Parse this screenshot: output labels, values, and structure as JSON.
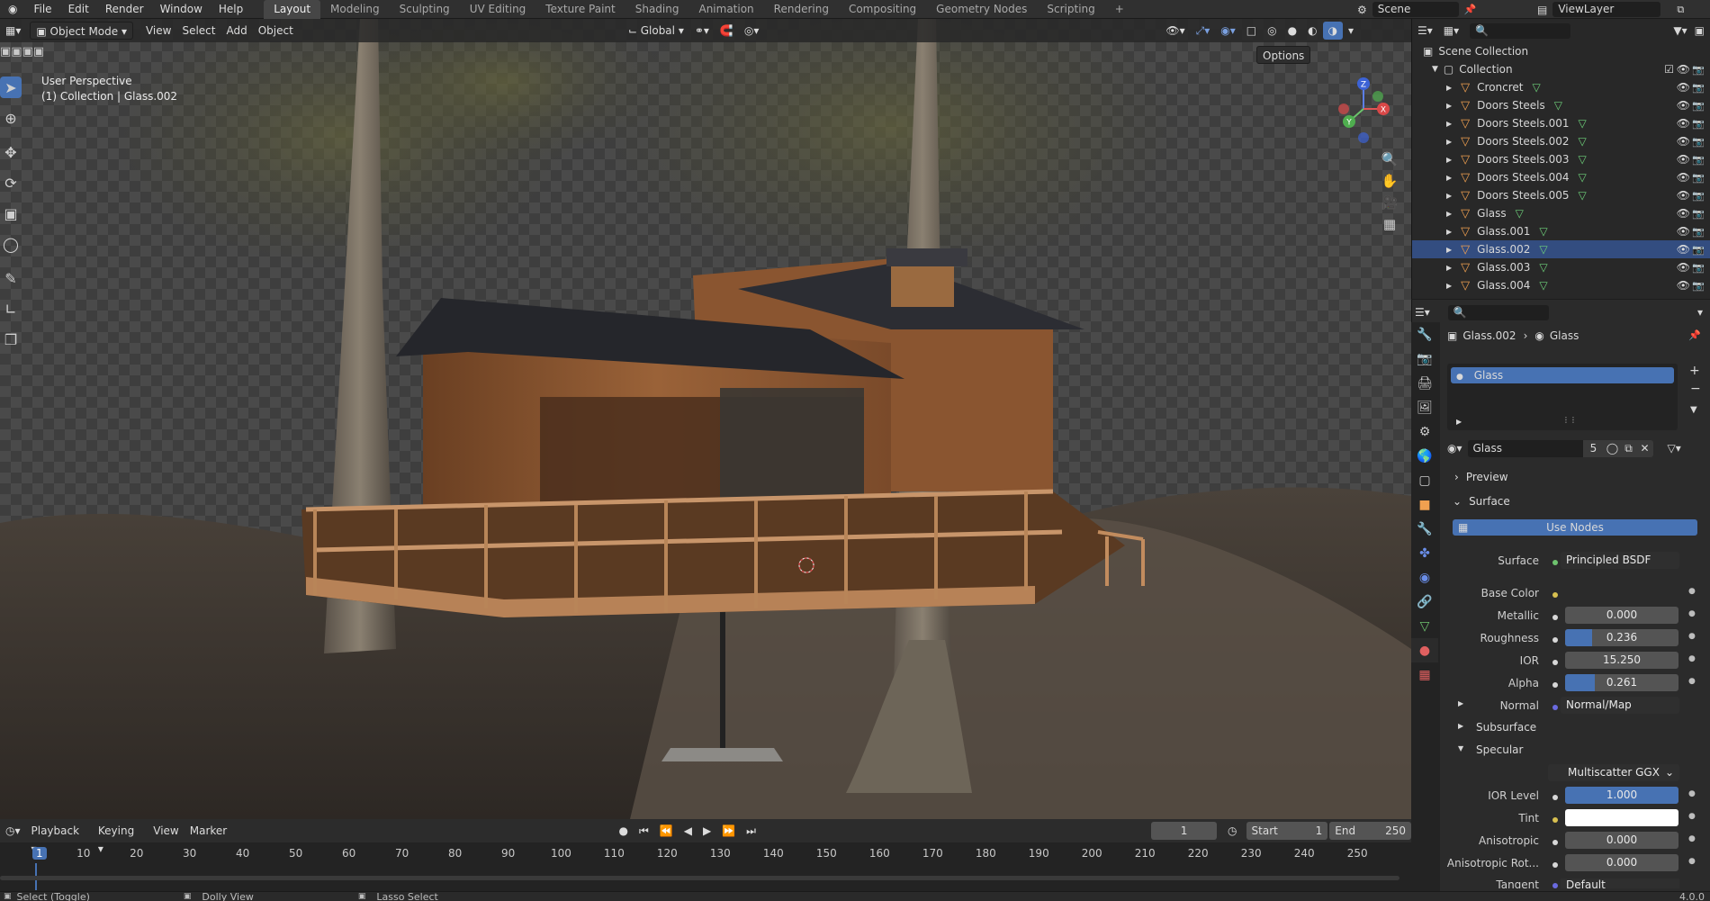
{
  "topbar": {
    "menus": [
      "File",
      "Edit",
      "Render",
      "Window",
      "Help"
    ],
    "workspaces": [
      "Layout",
      "Modeling",
      "Sculpting",
      "UV Editing",
      "Texture Paint",
      "Shading",
      "Animation",
      "Rendering",
      "Compositing",
      "Geometry Nodes",
      "Scripting"
    ],
    "active_workspace": "Layout",
    "add_tab": "+",
    "scene": "Scene",
    "view_layer": "ViewLayer"
  },
  "viewport_header": {
    "mode": "Object Mode",
    "menus": [
      "View",
      "Select",
      "Add",
      "Object"
    ],
    "orientation": "Global",
    "options": "Options"
  },
  "viewport": {
    "view_name": "User Perspective",
    "context": "(1) Collection | Glass.002",
    "gizmo": {
      "z": "Z",
      "y": "Y",
      "x": "X"
    }
  },
  "outliner": {
    "scene_collection": "Scene Collection",
    "collection": "Collection",
    "items": [
      {
        "name": "Croncret",
        "selected": false
      },
      {
        "name": "Doors Steels",
        "selected": false
      },
      {
        "name": "Doors Steels.001",
        "selected": false
      },
      {
        "name": "Doors Steels.002",
        "selected": false
      },
      {
        "name": "Doors Steels.003",
        "selected": false
      },
      {
        "name": "Doors Steels.004",
        "selected": false
      },
      {
        "name": "Doors Steels.005",
        "selected": false
      },
      {
        "name": "Glass",
        "selected": false
      },
      {
        "name": "Glass.001",
        "selected": false
      },
      {
        "name": "Glass.002",
        "selected": true
      },
      {
        "name": "Glass.003",
        "selected": false
      },
      {
        "name": "Glass.004",
        "selected": false
      }
    ]
  },
  "properties": {
    "breadcrumb_object": "Glass.002",
    "breadcrumb_material": "Glass",
    "slot": "Glass",
    "material_name": "Glass",
    "users": "5",
    "preview": "Preview",
    "surface_section": "Surface",
    "use_nodes": "Use Nodes",
    "surface_label": "Surface",
    "surface_value": "Principled BSDF",
    "base_color_label": "Base Color",
    "metallic_label": "Metallic",
    "metallic_value": "0.000",
    "roughness_label": "Roughness",
    "roughness_value": "0.236",
    "roughness_fill": 0.236,
    "ior_label": "IOR",
    "ior_value": "15.250",
    "alpha_label": "Alpha",
    "alpha_value": "0.261",
    "alpha_fill": 0.261,
    "normal_label": "Normal",
    "normal_value": "Normal/Map",
    "subsurface": "Subsurface",
    "specular": "Specular",
    "distribution": "Multiscatter GGX",
    "ior_level_label": "IOR Level",
    "ior_level_value": "1.000",
    "ior_level_fill": 1.0,
    "tint_label": "Tint",
    "anisotropic_label": "Anisotropic",
    "anisotropic_value": "0.000",
    "anisotropic_rot_label": "Anisotropic Rot...",
    "anisotropic_rot_value": "0.000",
    "tangent_label": "Tangent",
    "tangent_value": "Default"
  },
  "timeline": {
    "menus": [
      "Playback",
      "Keying",
      "View",
      "Marker"
    ],
    "current_frame": "1",
    "start_label": "Start",
    "start": "1",
    "end_label": "End",
    "end": "250",
    "ticks": [
      "1",
      "10",
      "20",
      "30",
      "40",
      "50",
      "60",
      "70",
      "80",
      "90",
      "100",
      "110",
      "120",
      "130",
      "140",
      "150",
      "160",
      "170",
      "180",
      "190",
      "200",
      "210",
      "220",
      "230",
      "240",
      "250"
    ]
  },
  "statusbar": {
    "left": "Select (Toggle)",
    "middle": "Dolly View",
    "right": "Lasso Select",
    "version": "4.0.0"
  }
}
